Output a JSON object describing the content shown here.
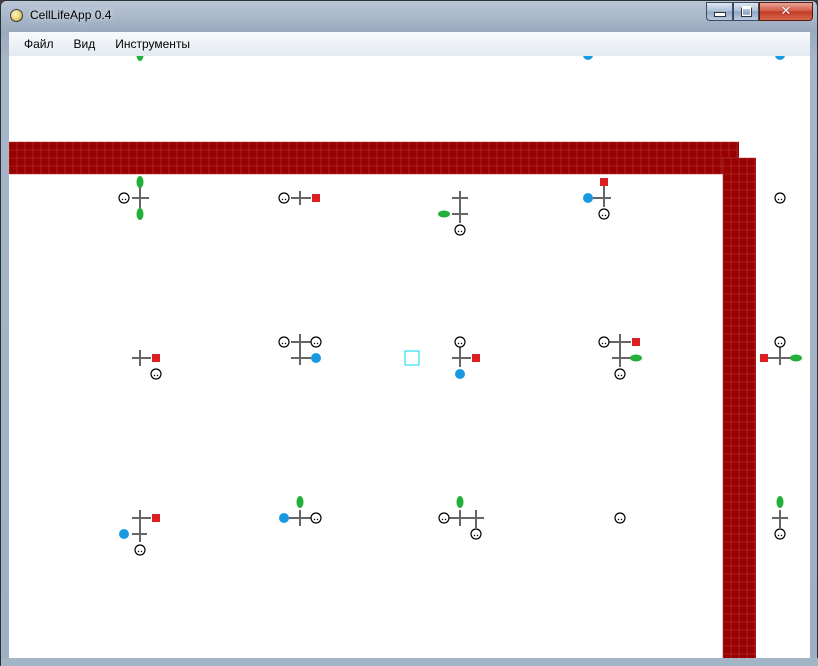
{
  "window": {
    "title": "CellLifeApp 0.4",
    "app_icon": "app-circle-icon",
    "controls": {
      "minimize": "minimize-icon",
      "maximize": "maximize-icon",
      "close": "close-icon",
      "close_glyph": "✕"
    }
  },
  "menu": {
    "items": [
      "Файл",
      "Вид",
      "Инструменты"
    ]
  },
  "colors": {
    "wall": "#990000",
    "wall_grid": "#b33a3a",
    "connector": "#666666",
    "food_green": "#22b03a",
    "eye_blue": "#1899e0",
    "weapon_red": "#e02020",
    "selection": "#00d8e8"
  },
  "organs": {
    "green": "leaf-organ-icon",
    "blue": "eye-organ-icon",
    "red": "weapon-organ-icon",
    "face": "face-organ-icon"
  }
}
